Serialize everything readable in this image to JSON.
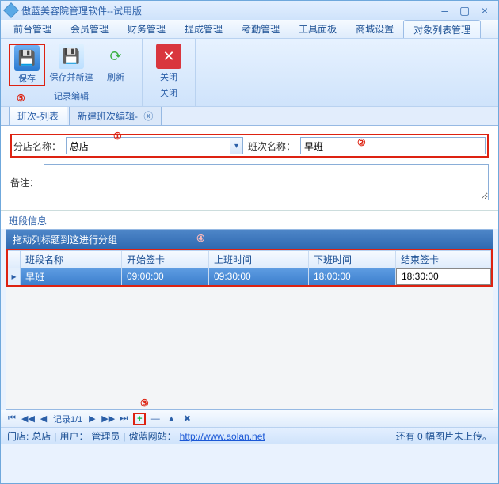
{
  "title": "傲蓝美容院管理软件--试用版",
  "menus": [
    "前台管理",
    "会员管理",
    "财务管理",
    "提成管理",
    "考勤管理",
    "工具面板",
    "商城设置",
    "对象列表管理"
  ],
  "menu_active_index": 7,
  "ribbon": {
    "group1": {
      "label": "记录编辑",
      "save_label": "保存",
      "savenew_label": "保存并新建",
      "refresh_label": "刷新"
    },
    "group2": {
      "label": "关闭",
      "close_label": "关闭"
    }
  },
  "annotations": {
    "a1": "①",
    "a2": "②",
    "a3": "③",
    "a4": "④",
    "a5": "⑤"
  },
  "tabs2": {
    "tab1": "班次-列表",
    "tab2": "新建班次编辑-"
  },
  "form": {
    "store_label": "分店名称：",
    "store_value": "总店",
    "shift_label": "班次名称：",
    "shift_value": "早班",
    "remark_label": "备注："
  },
  "section_title": "班段信息",
  "grid": {
    "group_hint": "拖动列标题到这进行分组",
    "headers": [
      "班段名称",
      "开始签卡",
      "上班时间",
      "下班时间",
      "结束签卡"
    ],
    "rows": [
      {
        "name": "早班",
        "start_card": "09:00:00",
        "on": "09:30:00",
        "off": "18:00:00",
        "end_card": "18:30:00"
      }
    ]
  },
  "navigator": {
    "record": "记录1/1"
  },
  "status": {
    "store_label": "门店:",
    "store_value": "总店",
    "user_label": "用户：",
    "user_value": "管理员",
    "site_label": "傲蓝网站：",
    "site_url": "http://www.aolan.net",
    "upload_hint": "还有 0 幅图片未上传。"
  }
}
